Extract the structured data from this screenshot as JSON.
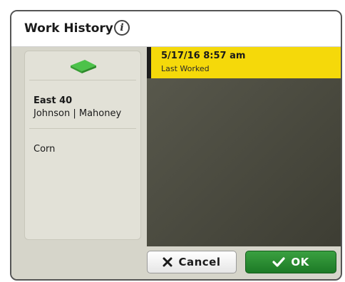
{
  "header": {
    "title": "Work History",
    "info_icon": "info-icon"
  },
  "field": {
    "name": "East 40",
    "client_farm": "Johnson | Mahoney",
    "crop": "Corn",
    "icon": "tractor-icon"
  },
  "history": [
    {
      "date": "5/17/16 8:57 am",
      "label": "Last Worked"
    }
  ],
  "footer": {
    "cancel_label": "Cancel",
    "ok_label": "OK"
  },
  "colors": {
    "selected": "#f5d90a",
    "ok_button": "#2a8c32",
    "field_icon": "#3fae3a",
    "dark_panel": "#4a4a3f"
  }
}
